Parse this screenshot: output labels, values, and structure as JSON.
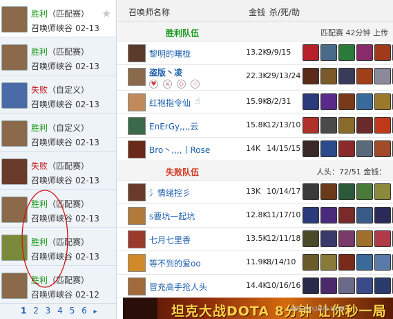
{
  "left": {
    "matches": [
      {
        "result": "胜利",
        "type": "win",
        "mode": "（匹配赛）",
        "map": "召唤师峡谷",
        "date": "02-13",
        "avatar_color": "#8a6a4a"
      },
      {
        "result": "胜利",
        "type": "win",
        "mode": "（匹配赛）",
        "map": "召唤师峡谷",
        "date": "02-13",
        "avatar_color": "#8a6a4a"
      },
      {
        "result": "失败",
        "type": "loss",
        "mode": "（自定义）",
        "map": "召唤师峡谷",
        "date": "02-13",
        "avatar_color": "#4b6aa8"
      },
      {
        "result": "胜利",
        "type": "win",
        "mode": "（自定义）",
        "map": "召唤师峡谷",
        "date": "02-13",
        "avatar_color": "#8a6a4a"
      },
      {
        "result": "失败",
        "type": "loss",
        "mode": "（匹配赛）",
        "map": "召唤师峡谷",
        "date": "02-13",
        "avatar_color": "#6a3a2a"
      },
      {
        "result": "胜利",
        "type": "win",
        "mode": "（匹配赛）",
        "map": "召唤师峡谷",
        "date": "02-13",
        "avatar_color": "#8a6a4a"
      },
      {
        "result": "胜利",
        "type": "win",
        "mode": "（匹配赛）",
        "map": "召唤师峡谷",
        "date": "02-13",
        "avatar_color": "#7a8a3a"
      },
      {
        "result": "胜利",
        "type": "win",
        "mode": "（匹配赛）",
        "map": "召唤师峡谷",
        "date": "02-12",
        "avatar_color": "#8a6a4a"
      }
    ],
    "pager": [
      "1",
      "2",
      "3",
      "4",
      "5",
      "6"
    ],
    "pager_arrow": "▸"
  },
  "header": {
    "col_name": "召唤师名称",
    "col_gold": "金钱",
    "col_kda": "杀/死/助"
  },
  "win_team": {
    "label": "胜利队伍",
    "info": "匹配赛  42分钟 上传"
  },
  "loss_team": {
    "label": "失败队伍",
    "info": "人头：72/51 金钱："
  },
  "win_players": [
    {
      "name": "黎明的曙栊",
      "gold": "13.2K",
      "kda": "9/9/15",
      "avatar_color": "#5a3a2a"
    },
    {
      "name": "盗版丶凌",
      "gold": "22.3K",
      "kda": "29/13/24",
      "avatar_color": "#8a6a4a"
    },
    {
      "name": "红袍指令仙",
      "gold": "15.9K",
      "kda": "8/2/31",
      "avatar_color": "#c08a5a"
    },
    {
      "name": "EnErGy,,,,云",
      "gold": "15.8K",
      "kda": "12/13/10",
      "avatar_color": "#3a6a4a"
    },
    {
      "name": "Bro丶,,,,丨Rose",
      "gold": "14K",
      "kda": "14/15/15",
      "avatar_color": "#6a2a1a"
    }
  ],
  "loss_players": [
    {
      "name": "氵情绪控彡",
      "gold": "13K",
      "kda": "10/14/17",
      "avatar_color": "#6a3a2a"
    },
    {
      "name": "s要坑一起坑",
      "gold": "12.8K",
      "kda": "11/17/10",
      "avatar_color": "#b07a3a"
    },
    {
      "name": "七月七里香",
      "gold": "13.5K",
      "kda": "12/11/18",
      "avatar_color": "#9a3a2a"
    },
    {
      "name": "等不到的爱oo",
      "gold": "11.9K",
      "kda": "8/14/10",
      "avatar_color": "#d08a2a"
    },
    {
      "name": "冒充高手抢人头",
      "gold": "14.4K",
      "kda": "10/16/16",
      "avatar_color": "#a06a3a"
    }
  ],
  "banner": {
    "text": "坦克大战DOTA 8分钟 让你秒一局"
  },
  "watermark": "BBS.KOUDAI.COM",
  "colors": {
    "win": "#1a9a1a",
    "loss": "#c0141a",
    "link": "#1b5fae"
  }
}
